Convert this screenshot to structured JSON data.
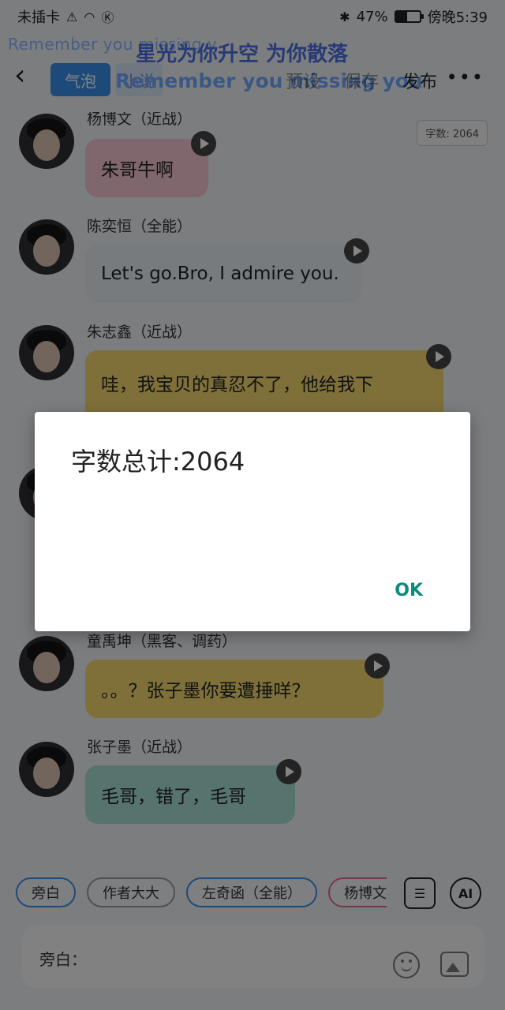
{
  "status_bar": {
    "carrier": "未插卡",
    "battery_percent_text": "47%",
    "battery_level": 0.47,
    "time": "傍晚5:39"
  },
  "top_bar": {
    "tab_active": "气泡",
    "tab_other": "小说",
    "marquee_top": "Remember you missing y",
    "marquee_cn": "星光为你升空 为你散落",
    "marquee_big": "Remember you missing you",
    "actions": [
      "预设",
      "保存",
      "发布"
    ]
  },
  "chat": {
    "word_count_badge": "字数: 2064",
    "messages": [
      {
        "name": "杨博文（近战）",
        "text": "朱哥牛啊",
        "bubble_color": "#f4c6d2"
      },
      {
        "name": "陈奕恒（全能）",
        "text": "Let's go.Bro, I admire you.",
        "bubble_color": "#e6ebf1"
      },
      {
        "name": "朱志鑫（近战）",
        "text": "哇，我宝贝的真忍不了，他给我下",
        "bubble_color": "#f4d770"
      },
      {
        "name": "童禹坤（黑客、调药）",
        "text": "。。？张子墨你要遭捶咩？",
        "bubble_color": "#f4d770"
      },
      {
        "name": "张子墨（近战）",
        "text": "毛哥，错了，毛哥",
        "bubble_color": "#a6ddd4"
      }
    ]
  },
  "chips": [
    "旁白",
    "作者大大",
    "左奇函（全能）",
    "杨博文"
  ],
  "side_buttons": {
    "card": "☰",
    "ai": "AI"
  },
  "input": {
    "label": "旁白："
  },
  "dialog": {
    "message": "字数总计:2064",
    "ok_label": "OK"
  }
}
